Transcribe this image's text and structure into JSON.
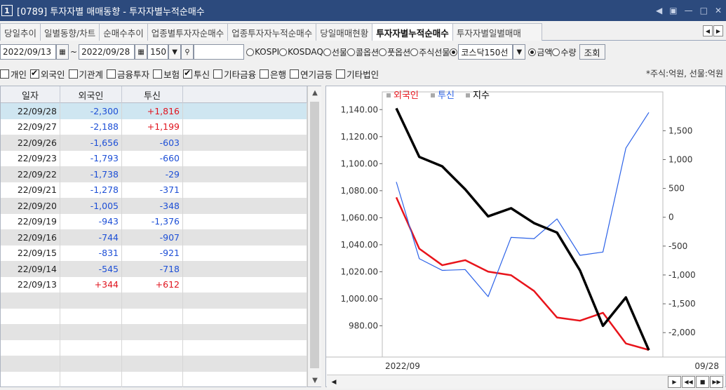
{
  "window": {
    "number": "1",
    "title": "[0789] 투자자별 매매동향 - 투자자별누적순매수"
  },
  "tabs": [
    "당일추이",
    "일별동향/차트",
    "순매수추이",
    "업종별투자자순매수",
    "업종투자자누적순매수",
    "당일매매현황",
    "투자자별누적순매수",
    "투자자별일별매매"
  ],
  "active_tab": 6,
  "toolbar": {
    "start_date": "2022/09/13",
    "tilde": "~",
    "end_date": "2022/09/28",
    "count": "150",
    "markets": [
      "KOSPI",
      "KOSDAQ",
      "선물",
      "콜옵션",
      "풋옵션",
      "주식선물"
    ],
    "market_selected": "코스닥150선",
    "units": [
      "금액",
      "수량"
    ],
    "unit_selected": 0,
    "query_label": "조회"
  },
  "checks": [
    {
      "label": "개인",
      "on": false
    },
    {
      "label": "외국인",
      "on": true
    },
    {
      "label": "기관계",
      "on": false
    },
    {
      "label": "금융투자",
      "on": false
    },
    {
      "label": "보험",
      "on": false
    },
    {
      "label": "투신",
      "on": true
    },
    {
      "label": "기타금융",
      "on": false
    },
    {
      "label": "은행",
      "on": false
    },
    {
      "label": "연기금등",
      "on": false
    },
    {
      "label": "기타법인",
      "on": false
    }
  ],
  "unit_note": "*주식:억원, 선물:억원",
  "table": {
    "headers": [
      "일자",
      "외국인",
      "투신"
    ],
    "rows": [
      [
        "22/09/28",
        "-2,300",
        "+1,816"
      ],
      [
        "22/09/27",
        "-2,188",
        "+1,199"
      ],
      [
        "22/09/26",
        "-1,656",
        "-603"
      ],
      [
        "22/09/23",
        "-1,793",
        "-660"
      ],
      [
        "22/09/22",
        "-1,738",
        "-29"
      ],
      [
        "22/09/21",
        "-1,278",
        "-371"
      ],
      [
        "22/09/20",
        "-1,005",
        "-348"
      ],
      [
        "22/09/19",
        "-943",
        "-1,376"
      ],
      [
        "22/09/16",
        "-744",
        "-907"
      ],
      [
        "22/09/15",
        "-831",
        "-921"
      ],
      [
        "22/09/14",
        "-545",
        "-718"
      ],
      [
        "22/09/13",
        "+344",
        "+612"
      ]
    ]
  },
  "chart_data": {
    "type": "line",
    "legend": [
      "외국인",
      "투신",
      "지수"
    ],
    "colors": {
      "외국인": "#e8141b",
      "투신": "#2d63e8",
      "지수": "#000000"
    },
    "x": [
      "22/09/13",
      "22/09/14",
      "22/09/15",
      "22/09/16",
      "22/09/19",
      "22/09/20",
      "22/09/21",
      "22/09/22",
      "22/09/23",
      "22/09/26",
      "22/09/27",
      "22/09/28"
    ],
    "series": [
      {
        "name": "외국인",
        "axis": "right",
        "values": [
          344,
          -545,
          -831,
          -744,
          -943,
          -1005,
          -1278,
          -1738,
          -1793,
          -1656,
          -2188,
          -2300
        ]
      },
      {
        "name": "투신",
        "axis": "right",
        "values": [
          612,
          -718,
          -921,
          -907,
          -1376,
          -348,
          -371,
          -29,
          -660,
          -603,
          1199,
          1816
        ]
      },
      {
        "name": "지수",
        "axis": "left",
        "values": [
          1141,
          1105,
          1098,
          1081,
          1061,
          1067,
          1056,
          1049,
          1021,
          980,
          1001,
          962
        ]
      }
    ],
    "left_ticks": [
      "1,140.00",
      "1,120.00",
      "1,100.00",
      "1,080.00",
      "1,060.00",
      "1,040.00",
      "1,020.00",
      "1,000.00",
      "980.00"
    ],
    "left_range": [
      960,
      1150
    ],
    "right_ticks": [
      "1,500",
      "1,000",
      "500",
      "0",
      "-500",
      "-1,000",
      "-1,500",
      "-2,000"
    ],
    "right_range": [
      -2350,
      2100
    ],
    "x_label_left": "2022/09",
    "x_label_right": "09/28"
  }
}
